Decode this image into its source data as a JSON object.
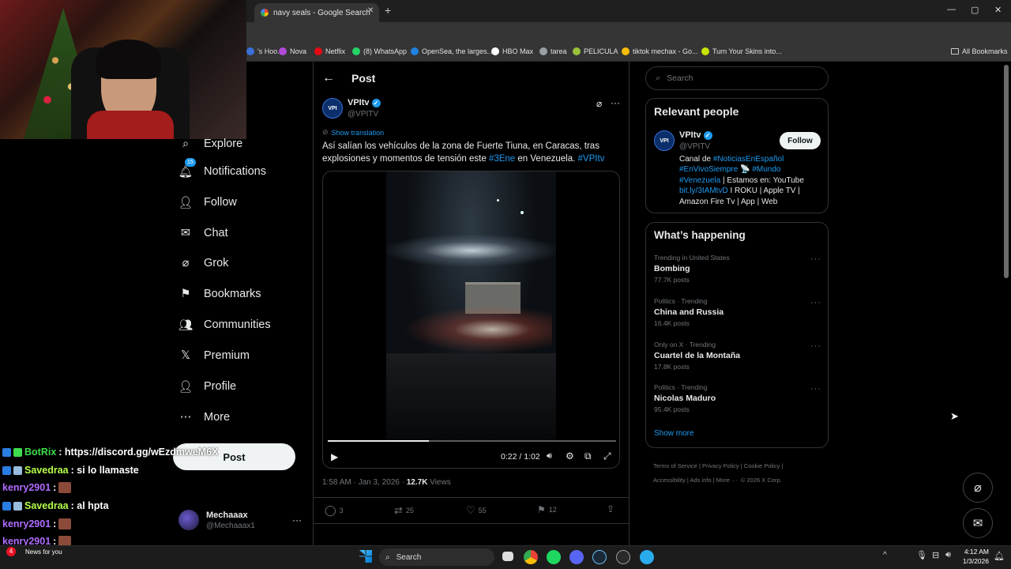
{
  "browser": {
    "tab_title": "navy seals - Google Search",
    "new_tab": "+",
    "window_controls": [
      "—",
      "▢",
      "✕"
    ],
    "bookmarks": [
      {
        "label": "'s Hoo...",
        "color": "#3a6fd8"
      },
      {
        "label": "Nova",
        "color": "#b04ad8"
      },
      {
        "label": "Netflix",
        "color": "#e50914"
      },
      {
        "label": "(8) WhatsApp",
        "color": "#25d366"
      },
      {
        "label": "OpenSea, the larges...",
        "color": "#2081e2"
      },
      {
        "label": "HBO Max",
        "color": "#ffffff"
      },
      {
        "label": "tarea",
        "color": "#9aa0a6"
      },
      {
        "label": "PELICULA",
        "color": "#9ac23c"
      },
      {
        "label": "tiktok mechax - Go...",
        "color": "#fbbc04"
      },
      {
        "label": "Turn Your Skins into...",
        "color": "#c8e400"
      }
    ],
    "all_bookmarks": "All Bookmarks"
  },
  "nav": {
    "items": [
      {
        "label": "Explore",
        "icon": "search-icon"
      },
      {
        "label": "Notifications",
        "icon": "bell-icon",
        "badge": "15"
      },
      {
        "label": "Follow",
        "icon": "person-add-icon"
      },
      {
        "label": "Chat",
        "icon": "mail-icon"
      },
      {
        "label": "Grok",
        "icon": "grok-icon"
      },
      {
        "label": "Bookmarks",
        "icon": "bookmark-icon"
      },
      {
        "label": "Communities",
        "icon": "communities-icon"
      },
      {
        "label": "Premium",
        "icon": "x-logo-icon"
      },
      {
        "label": "Profile",
        "icon": "person-icon"
      },
      {
        "label": "More",
        "icon": "more-circle-icon"
      }
    ],
    "post_label": "Post",
    "account": {
      "name": "Mechaaax",
      "handle": "@Mechaaax1",
      "more": "···"
    }
  },
  "chat": [
    {
      "user": "BotRix",
      "color": "#3ddc4b",
      "msg": ": https://discord.gg/wEzdmweM6X"
    },
    {
      "user": "Savedraa",
      "color": "#b6ff4a",
      "msg": ": si lo llamaste"
    },
    {
      "user": "kenry2901",
      "color": "#b06cff",
      "msg": ":",
      "emote": true
    },
    {
      "user": "Savedraa",
      "color": "#b6ff4a",
      "msg": ": al hpta"
    },
    {
      "user": "kenry2901",
      "color": "#b06cff",
      "msg": ":",
      "emote": true
    },
    {
      "user": "kenry2901",
      "color": "#b06cff",
      "msg": ":",
      "emote": true
    },
    {
      "user": "kenry2901",
      "color": "#b06cff",
      "msg": ":",
      "emote": true
    }
  ],
  "post": {
    "header": "Post",
    "author": "VPItv",
    "handle": "@VPITV",
    "avatar_text": "VPI",
    "show_translation": "Show translation",
    "text_before": "Así salían los vehículos de la zona de Fuerte Tiuna, en Caracas, tras explosiones y momentos de tensión este ",
    "hashtag1": "#3Ene",
    "text_mid": " en Venezuela. ",
    "hashtag2": "#VPItv",
    "video_time": "0:22 / 1:02",
    "video_progress": 0.35,
    "timestamp": "1:58 AM · Jan 3, 2026 · ",
    "views_count": "12.7K",
    "views_label": " Views",
    "replies": "3",
    "reposts": "25",
    "likes": "55",
    "bookmarks": "12"
  },
  "sidebar": {
    "search_placeholder": "Search",
    "relevant_title": "Relevant people",
    "person": {
      "name": "VPItv",
      "handle": "@VPITV",
      "follow": "Follow",
      "bio_prefix": "Canal de ",
      "tag1": "#NoticiasEnEspañol",
      "tag2": "#EnVivoSiempre",
      "emoji": "📡",
      "tag3": "#Mundo",
      "tag4": "#Venezuela",
      "bio_mid": " | Estamos en: YouTube ",
      "link": "bit.ly/3IAMtvD",
      "bio_end": " I ROKU | Apple TV | Amazon Fire Tv | App | Web"
    },
    "happening_title": "What’s happening",
    "trends": [
      {
        "meta": "Trending in United States",
        "name": "Bombing",
        "count": "77.7K posts"
      },
      {
        "meta": "Politics · Trending",
        "name": "China and Russia",
        "count": "16.4K posts"
      },
      {
        "meta": "Only on X · Trending",
        "name": "Cuartel de la Montaña",
        "count": "17.8K posts"
      },
      {
        "meta": "Politics · Trending",
        "name": "Nicolas Maduro",
        "count": "95.4K posts"
      }
    ],
    "show_more": "Show more",
    "footer": [
      "Terms of Service",
      "Privacy Policy",
      "Cookie Policy",
      "Accessibility",
      "Ads info",
      "More ···",
      "© 2026 X Corp."
    ]
  },
  "taskbar": {
    "search": "Search",
    "news": "News for you",
    "news_badge": "4",
    "time": "4:12 AM",
    "date": "1/3/2026"
  }
}
